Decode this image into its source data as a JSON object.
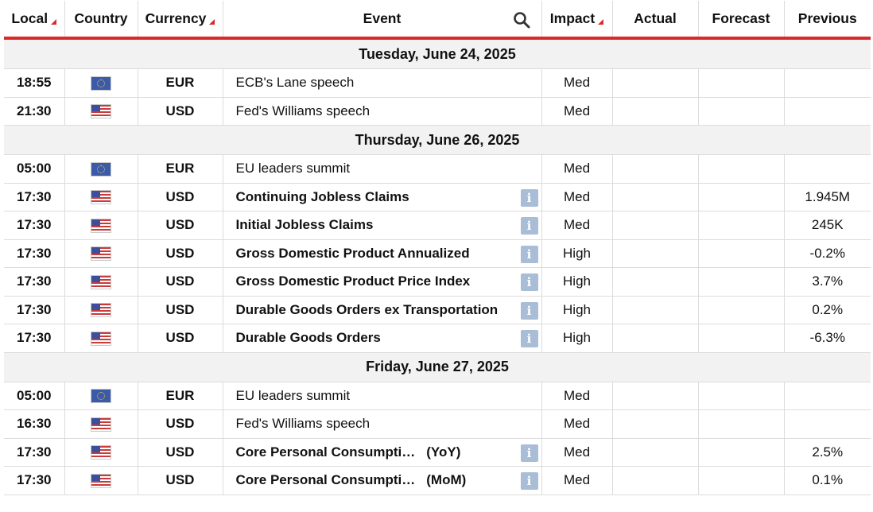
{
  "header": {
    "local": "Local",
    "country": "Country",
    "currency": "Currency",
    "event": "Event",
    "impact": "Impact",
    "actual": "Actual",
    "forecast": "Forecast",
    "previous": "Previous"
  },
  "colors": {
    "accent": "#d9292b",
    "date_row_bg": "#f2f2f2",
    "info_icon": "#a9bdd6"
  },
  "days": [
    {
      "date": "Tuesday, June 24, 2025",
      "events": [
        {
          "time": "18:55",
          "flag": "eu-flag-icon",
          "currency": "EUR",
          "event": "ECB's Lane speech",
          "suffix": "",
          "bold": false,
          "info": false,
          "impact": "Med",
          "actual": "",
          "forecast": "",
          "previous": ""
        },
        {
          "time": "21:30",
          "flag": "us-flag-icon",
          "currency": "USD",
          "event": "Fed's Williams speech",
          "suffix": "",
          "bold": false,
          "info": false,
          "impact": "Med",
          "actual": "",
          "forecast": "",
          "previous": ""
        }
      ]
    },
    {
      "date": "Thursday, June 26, 2025",
      "events": [
        {
          "time": "05:00",
          "flag": "eu-flag-icon",
          "currency": "EUR",
          "event": "EU leaders summit",
          "suffix": "",
          "bold": false,
          "info": false,
          "impact": "Med",
          "actual": "",
          "forecast": "",
          "previous": ""
        },
        {
          "time": "17:30",
          "flag": "us-flag-icon",
          "currency": "USD",
          "event": "Continuing Jobless Claims",
          "suffix": "",
          "bold": true,
          "info": true,
          "impact": "Med",
          "actual": "",
          "forecast": "",
          "previous": "1.945M"
        },
        {
          "time": "17:30",
          "flag": "us-flag-icon",
          "currency": "USD",
          "event": "Initial Jobless Claims",
          "suffix": "",
          "bold": true,
          "info": true,
          "impact": "Med",
          "actual": "",
          "forecast": "",
          "previous": "245K"
        },
        {
          "time": "17:30",
          "flag": "us-flag-icon",
          "currency": "USD",
          "event": "Gross Domestic Product Annualized",
          "suffix": "",
          "bold": true,
          "info": true,
          "impact": "High",
          "actual": "",
          "forecast": "",
          "previous": "-0.2%"
        },
        {
          "time": "17:30",
          "flag": "us-flag-icon",
          "currency": "USD",
          "event": "Gross Domestic Product Price Index",
          "suffix": "",
          "bold": true,
          "info": true,
          "impact": "High",
          "actual": "",
          "forecast": "",
          "previous": "3.7%"
        },
        {
          "time": "17:30",
          "flag": "us-flag-icon",
          "currency": "USD",
          "event": "Durable Goods Orders ex Transportation",
          "suffix": "",
          "bold": true,
          "info": true,
          "impact": "High",
          "actual": "",
          "forecast": "",
          "previous": "0.2%"
        },
        {
          "time": "17:30",
          "flag": "us-flag-icon",
          "currency": "USD",
          "event": "Durable Goods Orders",
          "suffix": "",
          "bold": true,
          "info": true,
          "impact": "High",
          "actual": "",
          "forecast": "",
          "previous": "-6.3%"
        }
      ]
    },
    {
      "date": "Friday, June 27, 2025",
      "events": [
        {
          "time": "05:00",
          "flag": "eu-flag-icon",
          "currency": "EUR",
          "event": "EU leaders summit",
          "suffix": "",
          "bold": false,
          "info": false,
          "impact": "Med",
          "actual": "",
          "forecast": "",
          "previous": ""
        },
        {
          "time": "16:30",
          "flag": "us-flag-icon",
          "currency": "USD",
          "event": "Fed's Williams speech",
          "suffix": "",
          "bold": false,
          "info": false,
          "impact": "Med",
          "actual": "",
          "forecast": "",
          "previous": ""
        },
        {
          "time": "17:30",
          "flag": "us-flag-icon",
          "currency": "USD",
          "event": "Core Personal Consumpti…",
          "suffix": "(YoY)",
          "bold": true,
          "info": true,
          "impact": "Med",
          "actual": "",
          "forecast": "",
          "previous": "2.5%"
        },
        {
          "time": "17:30",
          "flag": "us-flag-icon",
          "currency": "USD",
          "event": "Core Personal Consumpti…",
          "suffix": "(MoM)",
          "bold": true,
          "info": true,
          "impact": "Med",
          "actual": "",
          "forecast": "",
          "previous": "0.1%"
        }
      ]
    }
  ]
}
